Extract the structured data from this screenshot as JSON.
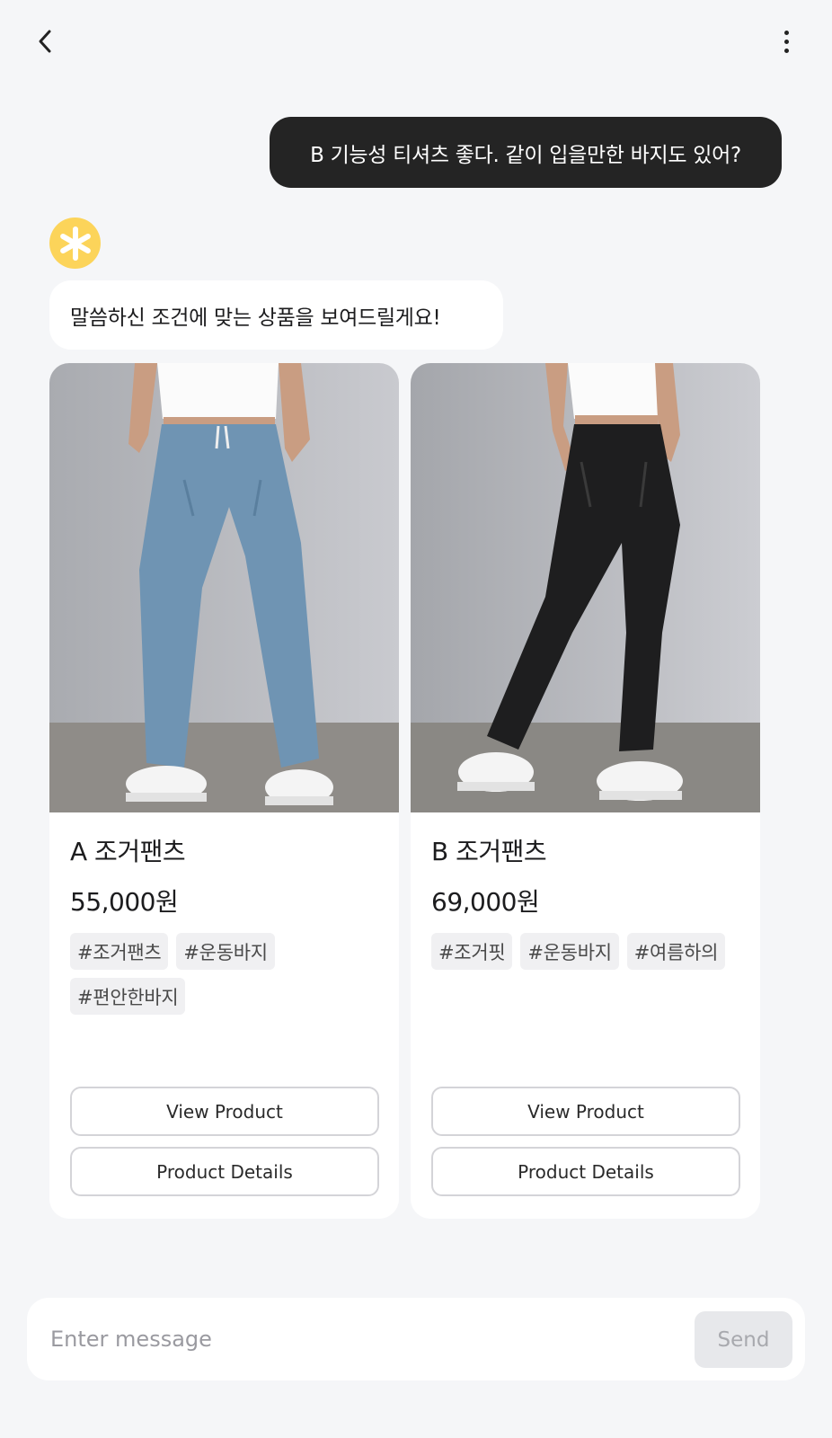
{
  "header": {
    "back_icon": "chevron-left-icon",
    "more_icon": "more-vertical-icon"
  },
  "chat": {
    "user_message": "B 기능성 티셔츠 좋다. 같이 입을만한 바지도 있어?",
    "bot_avatar_icon": "asterisk-icon",
    "bot_message": "말씀하신 조건에 맞는 상품을 보여드릴게요!"
  },
  "products": [
    {
      "name": "A 조거팬츠",
      "price": "55,000원",
      "tags": [
        "#조거팬츠",
        "#운동바지",
        "#편안한바지"
      ],
      "pants_color": "#6f94b3",
      "view_label": "View Product",
      "details_label": "Product Details"
    },
    {
      "name": "B 조거팬츠",
      "price": "69,000원",
      "tags": [
        "#조거핏",
        "#운동바지",
        "#여름하의"
      ],
      "pants_color": "#1e1e1f",
      "view_label": "View Product",
      "details_label": "Product Details"
    }
  ],
  "composer": {
    "placeholder": "Enter message",
    "send_label": "Send"
  },
  "colors": {
    "background": "#f5f6f8",
    "user_bubble": "#242424",
    "avatar": "#fcd45a",
    "send_button_disabled": "#e7e8eb"
  }
}
